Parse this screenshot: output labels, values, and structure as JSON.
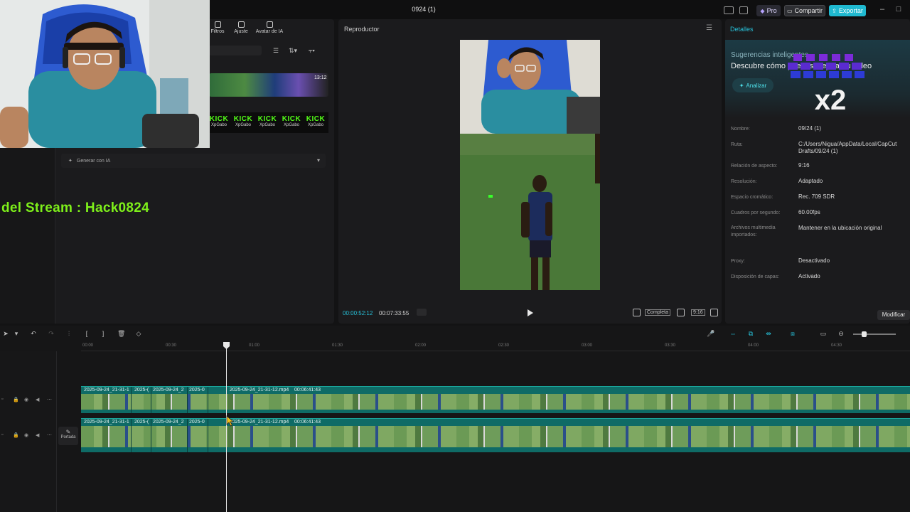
{
  "window": {
    "title": "0924 (1)"
  },
  "topbar": {
    "pro_label": "Pro",
    "share_label": "Compartir",
    "export_label": "Exportar"
  },
  "media": {
    "tabs": [
      "Filtros",
      "Ajuste",
      "Avatar de IA"
    ],
    "thumb_duration": "13:12",
    "kick_items": [
      {
        "brand": "KICK",
        "user": "XpGabo"
      },
      {
        "brand": "KICK",
        "user": "XpGabo"
      },
      {
        "brand": "KICK",
        "user": "XpGabo"
      },
      {
        "brand": "KICK",
        "user": "XpGabo"
      },
      {
        "brand": "KICK",
        "user": "XpGabo"
      }
    ],
    "generate_label": "Generar con IA"
  },
  "overlay": {
    "stream_text": "del Stream : Hack0824"
  },
  "player": {
    "title": "Reproductor",
    "time_current": "00:00:52:12",
    "time_total": "00:07:33:55",
    "full_label": "Completa",
    "ratio_label": "9:16"
  },
  "details": {
    "title": "Detalles",
    "suggest_label": "Sugerencias inteligentes",
    "suggest_text": "Descubre cómo puedes mejorar tu video",
    "analyze_label": "Analizar",
    "badge_text": "x2",
    "fields": [
      {
        "k": "Nombre:",
        "v": "09/24 (1)"
      },
      {
        "k": "Ruta:",
        "v": "C:/Users/Nigua/AppData/Local/CapCut Drafts/09/24 (1)"
      },
      {
        "k": "Relación de aspecto:",
        "v": "9:16"
      },
      {
        "k": "Resolución:",
        "v": "Adaptado"
      },
      {
        "k": "Espacio cromático:",
        "v": "Rec. 709 SDR"
      },
      {
        "k": "Cuadros por segundo:",
        "v": "60.00fps"
      },
      {
        "k": "Archivos multimedia importados:",
        "v": "Mantener en la ubicación original"
      },
      {
        "k": "Proxy:",
        "v": "Desactivado"
      },
      {
        "k": "Disposición de capas:",
        "v": "Activado"
      }
    ],
    "modify_label": "Modificar"
  },
  "timeline": {
    "ticks": [
      "00:00",
      "00:30",
      "01:00",
      "01:30",
      "02:00",
      "02:30",
      "03:00",
      "03:30",
      "04:00",
      "04:30"
    ],
    "cover_label": "Portada",
    "clip_labels": [
      "2025-09-24_21-31-1",
      "2025-(",
      "2025-09-24_2",
      "2025-0",
      "2025-09-24_21-31-12.mp4",
      "00:06:41:43"
    ]
  },
  "colors": {
    "accent": "#1fb9d0",
    "clip": "#0f6b66",
    "overlay_text": "#7ef01a"
  }
}
